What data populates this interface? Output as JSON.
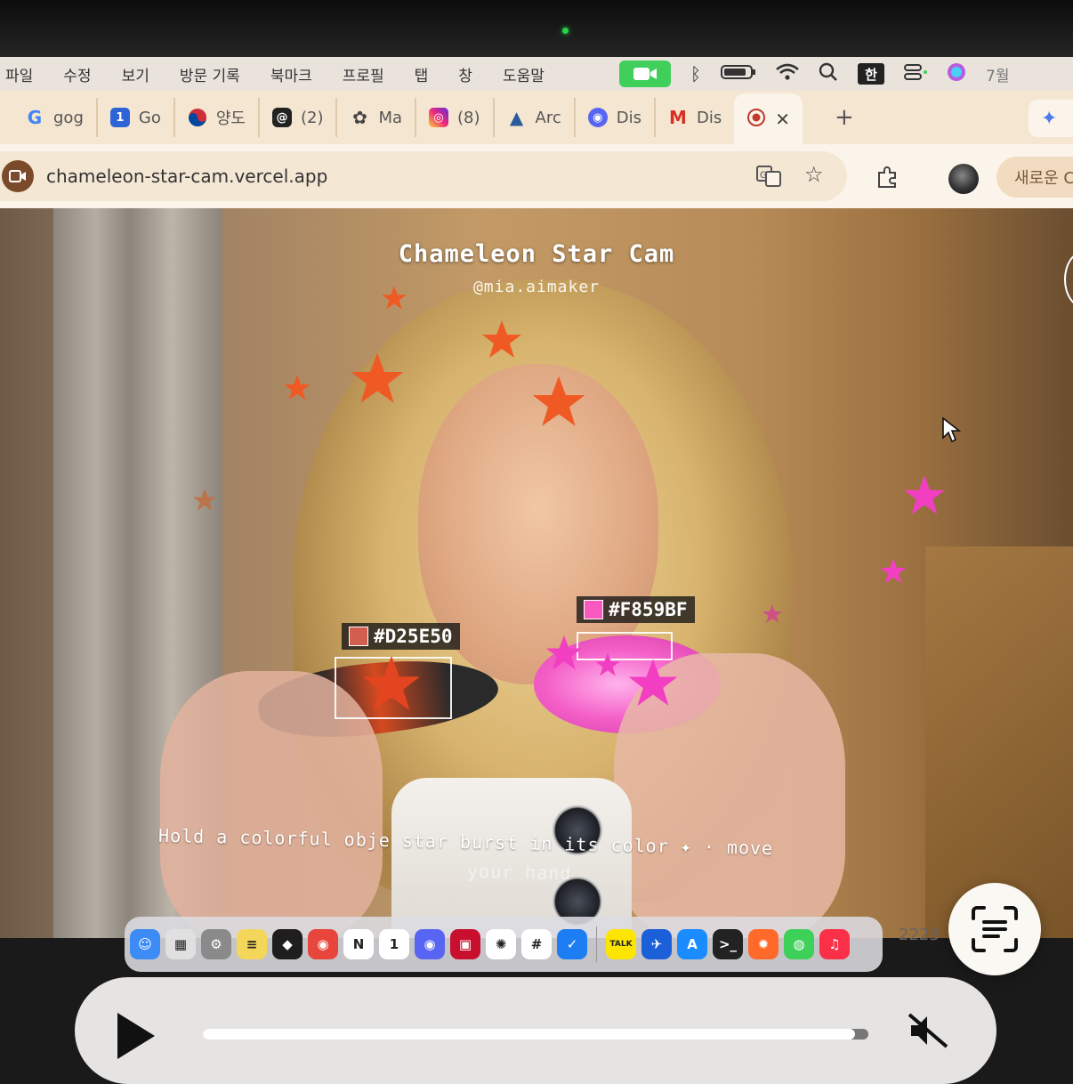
{
  "menubar": {
    "items": [
      "파일",
      "수정",
      "보기",
      "방문 기록",
      "북마크",
      "프로필",
      "탭",
      "창",
      "도움말"
    ],
    "input_source": "한",
    "clock": "7월"
  },
  "tabs": [
    {
      "label": "gog",
      "fav": "G",
      "color": "#4285f4",
      "name": "google"
    },
    {
      "label": "Go",
      "fav": "1",
      "color": "#2f64d6",
      "name": "google-calendar"
    },
    {
      "label": "양도",
      "fav": "◑",
      "color": "#cd2e3a",
      "name": "korea-gov"
    },
    {
      "label": "(2)",
      "fav": "@",
      "color": "#222222",
      "name": "threads"
    },
    {
      "label": "Ma",
      "fav": "✿",
      "color": "#444444",
      "name": "mastodon"
    },
    {
      "label": "(8)",
      "fav": "◎",
      "color": "#d62f8b",
      "name": "instagram"
    },
    {
      "label": "Arc",
      "fav": "▲",
      "color": "#2a5c9a",
      "name": "arc"
    },
    {
      "label": "Dis",
      "fav": "◉",
      "color": "#5865f2",
      "name": "discord"
    },
    {
      "label": "Dis",
      "fav": "M",
      "color": "#d93025",
      "name": "gmail"
    }
  ],
  "address": {
    "url": "chameleon-star-cam.vercel.app",
    "new_window_label": "새로운 C"
  },
  "app": {
    "title": "Chameleon Star Cam",
    "handle": "@mia.aimaker",
    "caption": "Hold a colorful obje  star burst in its color ✦  ·  move",
    "caption2": "your hand",
    "colors": [
      {
        "hex": "#D25E50",
        "label": "#D25E50"
      },
      {
        "hex": "#F859BF",
        "label": "#F859BF"
      }
    ]
  },
  "dock": {
    "items": [
      {
        "name": "finder",
        "color": "#3d8bf5",
        "glyph": "☺"
      },
      {
        "name": "launchpad",
        "color": "#e0e0e0",
        "glyph": "▦"
      },
      {
        "name": "settings",
        "color": "#8a8a8a",
        "glyph": "⚙"
      },
      {
        "name": "notes",
        "color": "#f3d65a",
        "glyph": "≡"
      },
      {
        "name": "figma",
        "color": "#1e1e1e",
        "glyph": "◆"
      },
      {
        "name": "chrome",
        "color": "#e8453c",
        "glyph": "◉"
      },
      {
        "name": "notion",
        "color": "#ffffff",
        "glyph": "N"
      },
      {
        "name": "calendar",
        "color": "#ffffff",
        "glyph": "1"
      },
      {
        "name": "discord",
        "color": "#5865f2",
        "glyph": "◉"
      },
      {
        "name": "photo-booth",
        "color": "#c8102e",
        "glyph": "▣"
      },
      {
        "name": "chatgpt",
        "color": "#ffffff",
        "glyph": "✺"
      },
      {
        "name": "slack",
        "color": "#ffffff",
        "glyph": "#"
      },
      {
        "name": "tasks",
        "color": "#1d7df2",
        "glyph": "✓"
      },
      {
        "name": "kakaotalk",
        "color": "#fee500",
        "glyph": "TALK"
      },
      {
        "name": "testflight",
        "color": "#1b5fd9",
        "glyph": "✈"
      },
      {
        "name": "app-store",
        "color": "#1a8cff",
        "glyph": "A"
      },
      {
        "name": "terminal",
        "color": "#222222",
        "glyph": ">_"
      },
      {
        "name": "sparkle-app",
        "color": "#ff6a2b",
        "glyph": "✹"
      },
      {
        "name": "messages",
        "color": "#3ed15a",
        "glyph": "◍"
      },
      {
        "name": "music",
        "color": "#fa3048",
        "glyph": "♫"
      }
    ],
    "bg_text": "2223"
  },
  "player": {
    "progress": 0.98
  },
  "colors": {
    "menubar": "#e9e3dc",
    "tabbar": "#f5e6d2",
    "star_orange": "#ef5a24",
    "star_pink": "#f23fc2"
  }
}
